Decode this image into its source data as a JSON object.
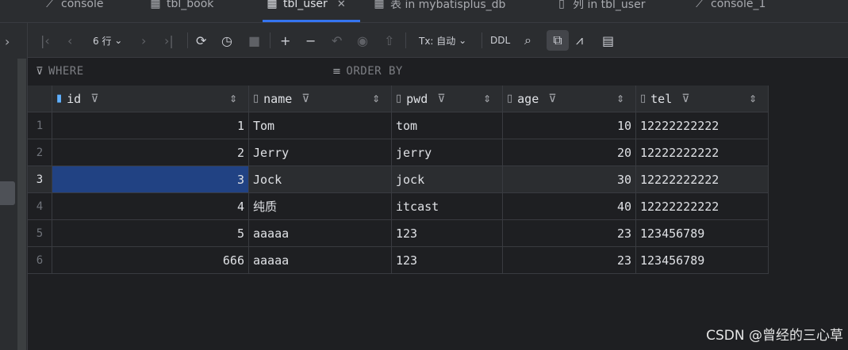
{
  "tabs": [
    {
      "label": "console",
      "icon": "console-icon"
    },
    {
      "label": "tbl_book",
      "icon": "table-icon"
    },
    {
      "label": "tbl_user",
      "icon": "table-icon",
      "active": true
    },
    {
      "label": "表 in mybatisplus_db",
      "icon": "table-icon"
    },
    {
      "label": "列 in tbl_user",
      "icon": "table-icon"
    },
    {
      "label": "console_1",
      "icon": "console-icon"
    }
  ],
  "toolbar": {
    "rows_label": "6 行",
    "tx_label": "Tx: 自动",
    "ddl_label": "DDL"
  },
  "filter": {
    "where_label": "WHERE",
    "order_label": "ORDER BY"
  },
  "columns": [
    {
      "label": "id",
      "icon": "key-column-icon"
    },
    {
      "label": "name",
      "icon": "column-icon"
    },
    {
      "label": "pwd",
      "icon": "column-icon"
    },
    {
      "label": "age",
      "icon": "column-icon"
    },
    {
      "label": "tel",
      "icon": "column-icon"
    }
  ],
  "rows": [
    {
      "num": "1",
      "id": "1",
      "name": "Tom",
      "pwd": "tom",
      "age": "10",
      "tel": "12222222222"
    },
    {
      "num": "2",
      "id": "2",
      "name": "Jerry",
      "pwd": "jerry",
      "age": "20",
      "tel": "12222222222"
    },
    {
      "num": "3",
      "id": "3",
      "name": "Jock",
      "pwd": "jock",
      "age": "30",
      "tel": "12222222222"
    },
    {
      "num": "4",
      "id": "4",
      "name": "纯质",
      "pwd": "itcast",
      "age": "40",
      "tel": "12222222222"
    },
    {
      "num": "5",
      "id": "5",
      "name": "aaaaa",
      "pwd": "123",
      "age": "23",
      "tel": "123456789"
    },
    {
      "num": "6",
      "id": "666",
      "name": "aaaaa",
      "pwd": "123",
      "age": "23",
      "tel": "123456789"
    }
  ],
  "watermark": "CSDN @曾经的三心草",
  "colors": {
    "accent": "#3574f0",
    "selection": "#214283",
    "background": "#1e1f22",
    "panel": "#2b2d30"
  }
}
